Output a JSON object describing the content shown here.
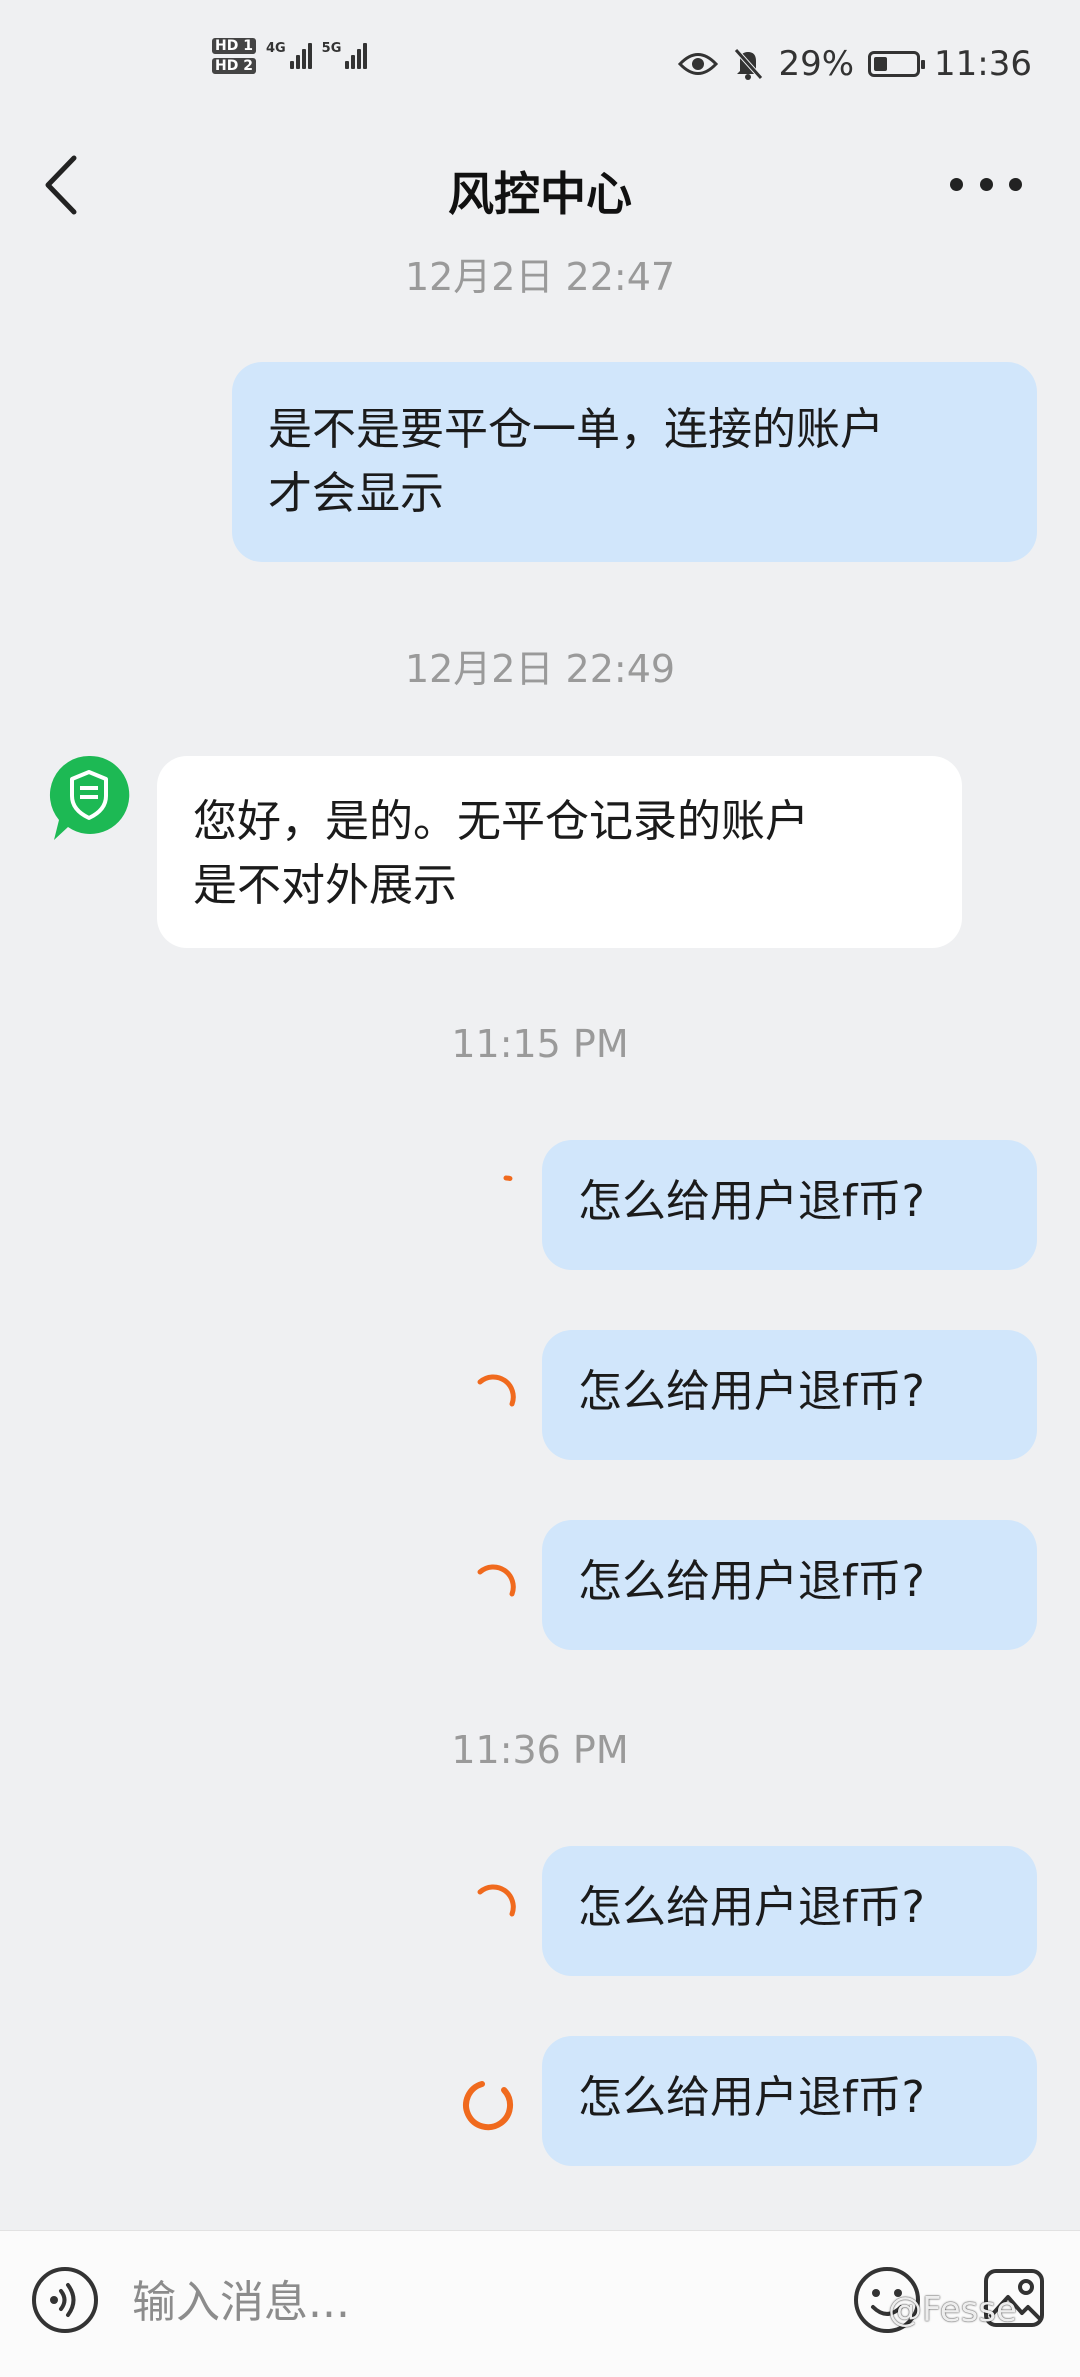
{
  "status_bar": {
    "hd1": "HD 1",
    "hd2": "HD 2",
    "net1": "4G",
    "net2": "5G",
    "battery_percent": "29%",
    "time": "11:36"
  },
  "header": {
    "title": "风控中心"
  },
  "messages": [
    {
      "type": "timestamp",
      "text": "12月2日 22:47"
    },
    {
      "type": "outgoing",
      "text": "是不是要平仓一单，连接的账户\n才会显示"
    },
    {
      "type": "timestamp",
      "text": "12月2日 22:49"
    },
    {
      "type": "incoming",
      "text": "您好，是的。无平仓记录的账户\n是不对外展示"
    },
    {
      "type": "timestamp",
      "text": "11:15 PM"
    },
    {
      "type": "outgoing",
      "text": "怎么给用户退f币?",
      "status": "sending"
    },
    {
      "type": "outgoing",
      "text": "怎么给用户退f币?",
      "status": "sending"
    },
    {
      "type": "outgoing",
      "text": "怎么给用户退f币?",
      "status": "sending"
    },
    {
      "type": "timestamp",
      "text": "11:36 PM"
    },
    {
      "type": "outgoing",
      "text": "怎么给用户退f币?",
      "status": "sending"
    },
    {
      "type": "outgoing",
      "text": "怎么给用户退f币?",
      "status": "sending"
    }
  ],
  "input": {
    "placeholder": "输入消息..."
  },
  "watermark": "@Fesse",
  "colors": {
    "outgoing_bubble": "#d1e6fb",
    "incoming_bubble": "#ffffff",
    "spinner": "#f06a1e",
    "avatar": "#1db954",
    "background": "#eff0f2"
  }
}
